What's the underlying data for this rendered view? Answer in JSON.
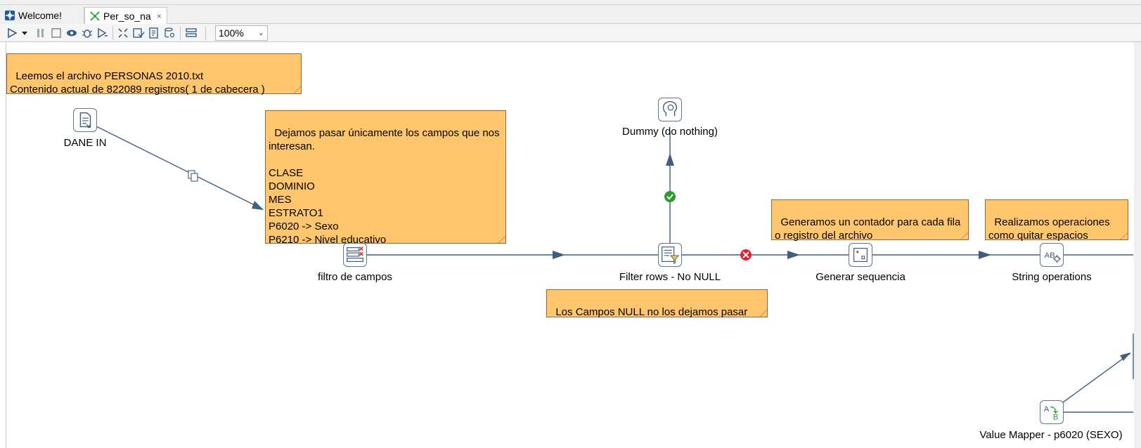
{
  "tabs": [
    {
      "label": "Welcome!",
      "icon": "welcome-icon"
    },
    {
      "label": "Per_so_na",
      "icon": "transformation-icon",
      "close": "×"
    }
  ],
  "toolbar": {
    "icons": [
      "run-icon",
      "run-dropdown-icon",
      "pause-icon",
      "stop-icon",
      "preview-icon",
      "debug-icon",
      "replay-icon",
      "verify-icon",
      "impact-icon",
      "sql-icon",
      "explore-db-icon",
      "show-results-icon"
    ],
    "zoom": "100%"
  },
  "notes": {
    "personas": "Leemos el archivo PERSONAS 2010.txt\nContenido actual de 822089 registros( 1 de cabecera )",
    "filtro": "Dejamos pasar únicamente los campos que nos interesan.\n\nCLASE\nDOMINIO\nMES\nESTRATO1\nP6020 -> Sexo\nP6210 -> Nivel educativo",
    "contador": "Generamos un contador para cada fila o registro del archivo",
    "operaciones": "Realizamos operaciones como quitar espacios",
    "nulls": "Los Campos NULL no los dejamos pasar"
  },
  "steps": {
    "dane_in": "DANE IN",
    "filtro_campos": "filtro de campos",
    "dummy": "Dummy (do nothing)",
    "filter_rows": "Filter rows - No NULL",
    "generar_sequencia": "Generar sequencia",
    "string_operations": "String operations",
    "value_mapper": "Value Mapper - p6020 (SEXO)"
  },
  "colors": {
    "note_bg": "#ffc66d",
    "hop": "#3f5f7f",
    "true_hop": "#2a9d2a",
    "false_hop": "#e0202a"
  }
}
